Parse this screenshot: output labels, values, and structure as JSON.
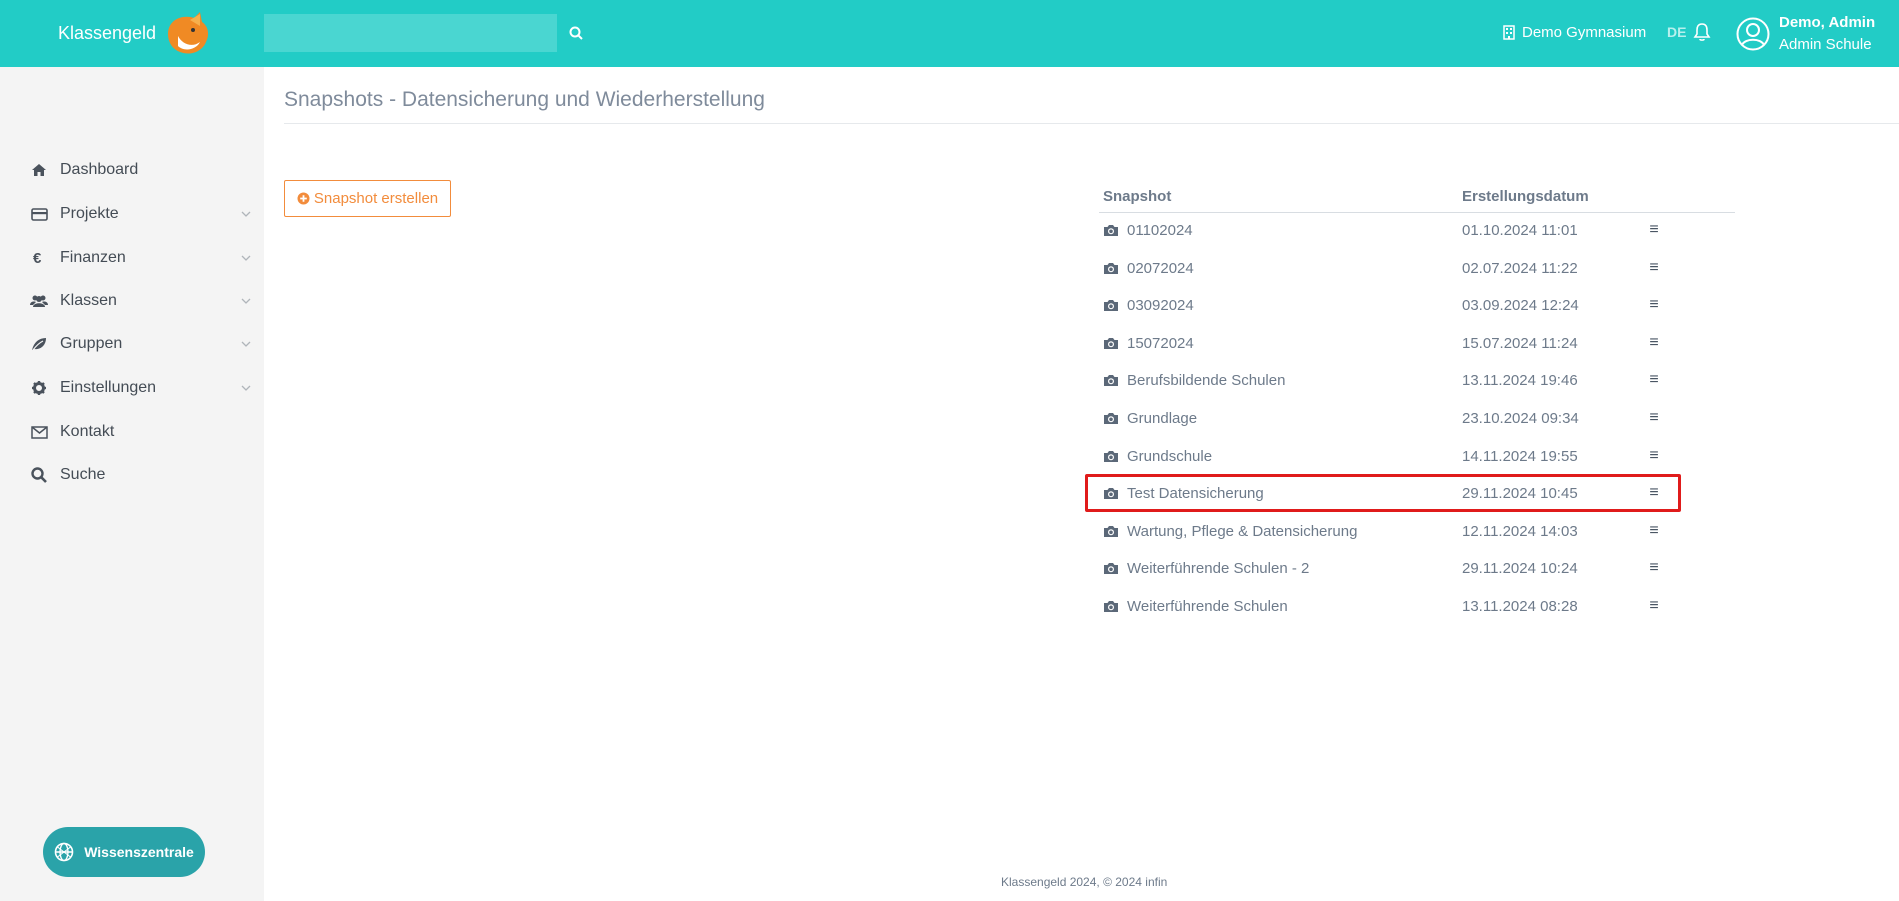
{
  "header": {
    "brand": "Klassengeld",
    "search_placeholder": "",
    "school": "Demo Gymnasium",
    "language": "DE",
    "user_name": "Demo, Admin",
    "user_role": "Admin Schule",
    "accent_color": "#22ccc6"
  },
  "sidebar": {
    "items": [
      {
        "label": "Dashboard",
        "icon": "home-icon"
      },
      {
        "label": "Projekte",
        "icon": "credit-card-icon"
      },
      {
        "label": "Finanzen",
        "icon": "euro-icon"
      },
      {
        "label": "Klassen",
        "icon": "users-icon"
      },
      {
        "label": "Gruppen",
        "icon": "leaf-icon"
      },
      {
        "label": "Einstellungen",
        "icon": "gear-icon"
      },
      {
        "label": "Kontakt",
        "icon": "envelope-icon"
      },
      {
        "label": "Suche",
        "icon": "search-icon"
      }
    ],
    "help_button": "Wissenszentrale"
  },
  "main": {
    "title": "Snapshots - Datensicherung und Wiederherstellung",
    "create_button": "Snapshot erstellen",
    "table": {
      "columns": [
        "Snapshot",
        "Erstellungsdatum"
      ],
      "rows": [
        {
          "name": "01102024",
          "date": "01.10.2024 11:01"
        },
        {
          "name": "02072024",
          "date": "02.07.2024 11:22"
        },
        {
          "name": "03092024",
          "date": "03.09.2024 12:24"
        },
        {
          "name": "15072024",
          "date": "15.07.2024 11:24"
        },
        {
          "name": "Berufsbildende Schulen",
          "date": "13.11.2024 19:46"
        },
        {
          "name": "Grundlage",
          "date": "23.10.2024 09:34"
        },
        {
          "name": "Grundschule",
          "date": "14.11.2024 19:55"
        },
        {
          "name": "Test Datensicherung",
          "date": "29.11.2024 10:45"
        },
        {
          "name": "Wartung, Pflege & Datensicherung",
          "date": "12.11.2024 14:03"
        },
        {
          "name": "Weiterführende Schulen - 2",
          "date": "29.11.2024 10:24"
        },
        {
          "name": "Weiterführende Schulen",
          "date": "13.11.2024 08:28"
        }
      ],
      "row_menu_glyph": "≡",
      "highlighted_row": "Test Datensicherung",
      "highlight_color": "#e01b1b"
    }
  },
  "footer": {
    "text": "Klassengeld 2024, © 2024 infin"
  }
}
